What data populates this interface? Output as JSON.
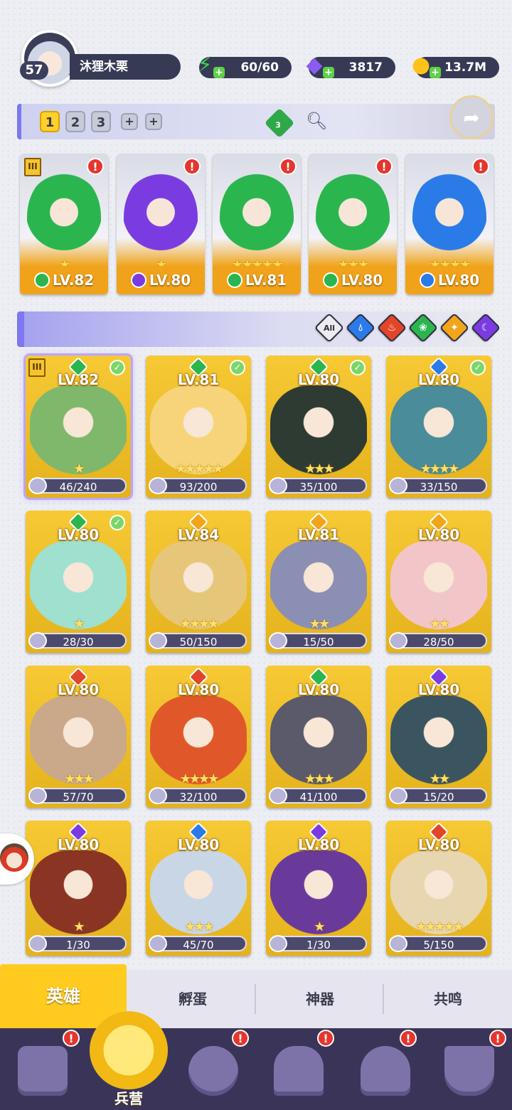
{
  "player": {
    "level": "57",
    "name": "沐狸木栗"
  },
  "resources": [
    {
      "name": "energy",
      "value": "60/60",
      "icon": "energy-bolt-icon",
      "color": "#3fd04d"
    },
    {
      "name": "gems",
      "value": "3817",
      "icon": "purple-gem-icon",
      "color": "#8a5cf0"
    },
    {
      "name": "gold",
      "value": "13.7M",
      "icon": "gold-coin-icon",
      "color": "#ffc21a"
    }
  ],
  "team_bar": {
    "tabs": [
      "1",
      "2",
      "3"
    ],
    "active_tab": "1",
    "gem_count": "3"
  },
  "team": [
    {
      "level": "LV.82",
      "element": "nature",
      "stars": 1,
      "alert": "!",
      "rank": "III"
    },
    {
      "level": "LV.80",
      "element": "shadow",
      "stars": 1,
      "alert": "!"
    },
    {
      "level": "LV.81",
      "element": "nature",
      "stars": 5,
      "alert": "!"
    },
    {
      "level": "LV.80",
      "element": "nature",
      "stars": 3,
      "alert": "!"
    },
    {
      "level": "LV.80",
      "element": "water",
      "stars": 4,
      "alert": "!"
    }
  ],
  "filters": {
    "all_label": "All",
    "elements": [
      "water",
      "fire",
      "nature",
      "light",
      "shadow"
    ]
  },
  "element_colors": {
    "nature": "#2bb54f",
    "shadow": "#7a3ce0",
    "water": "#2a7be8",
    "fire": "#e2452a",
    "light": "#f2a51b"
  },
  "heroes": [
    {
      "level": "LV.82",
      "element": "nature",
      "progress": "46/240",
      "stars": 1,
      "checked": true,
      "rank": "III",
      "selected": true,
      "art": "#7fb86b"
    },
    {
      "level": "LV.81",
      "element": "nature",
      "progress": "93/200",
      "stars": 5,
      "checked": true,
      "art": "#f7d37a"
    },
    {
      "level": "LV.80",
      "element": "nature",
      "progress": "35/100",
      "stars": 3,
      "checked": true,
      "art": "#2e3b33"
    },
    {
      "level": "LV.80",
      "element": "water",
      "progress": "33/150",
      "stars": 4,
      "checked": true,
      "art": "#4a8c99"
    },
    {
      "level": "LV.80",
      "element": "nature",
      "progress": "28/30",
      "stars": 1,
      "checked": true,
      "art": "#9fe0cf"
    },
    {
      "level": "LV.84",
      "element": "light",
      "progress": "50/150",
      "stars": 4,
      "art": "#e6c77a"
    },
    {
      "level": "LV.81",
      "element": "light",
      "progress": "15/50",
      "stars": 2,
      "art": "#8a8fb3"
    },
    {
      "level": "LV.80",
      "element": "light",
      "progress": "28/50",
      "stars": 2,
      "art": "#f2c6c9"
    },
    {
      "level": "LV.80",
      "element": "fire",
      "progress": "57/70",
      "stars": 3,
      "art": "#c9a98a"
    },
    {
      "level": "LV.80",
      "element": "fire",
      "progress": "32/100",
      "stars": 4,
      "art": "#e0582a"
    },
    {
      "level": "LV.80",
      "element": "nature",
      "progress": "41/100",
      "stars": 3,
      "art": "#5a5a6a"
    },
    {
      "level": "LV.80",
      "element": "shadow",
      "progress": "15/20",
      "stars": 2,
      "art": "#3a5560"
    },
    {
      "level": "LV.80",
      "element": "shadow",
      "progress": "1/30",
      "stars": 1,
      "art": "#8a3524"
    },
    {
      "level": "LV.80",
      "element": "water",
      "progress": "45/70",
      "stars": 3,
      "art": "#c9d6e6"
    },
    {
      "level": "LV.80",
      "element": "shadow",
      "progress": "1/30",
      "stars": 1,
      "art": "#6a3a9a"
    },
    {
      "level": "LV.80",
      "element": "fire",
      "progress": "5/150",
      "stars": 5,
      "art": "#e8d6b0"
    }
  ],
  "sub_tabs": [
    {
      "label": "英雄",
      "active": true
    },
    {
      "label": "孵蛋"
    },
    {
      "label": "神器"
    },
    {
      "label": "共鸣"
    }
  ],
  "bottom_nav": [
    {
      "icon": "cards-icon",
      "alert": "!"
    },
    {
      "icon": "barracks-icon",
      "label": "兵营",
      "active": true
    },
    {
      "icon": "book-icon",
      "alert": "!"
    },
    {
      "icon": "temple-icon",
      "alert": "!"
    },
    {
      "icon": "mushroom-icon",
      "alert": "!"
    },
    {
      "icon": "guild-banner-icon",
      "alert": "!"
    }
  ]
}
